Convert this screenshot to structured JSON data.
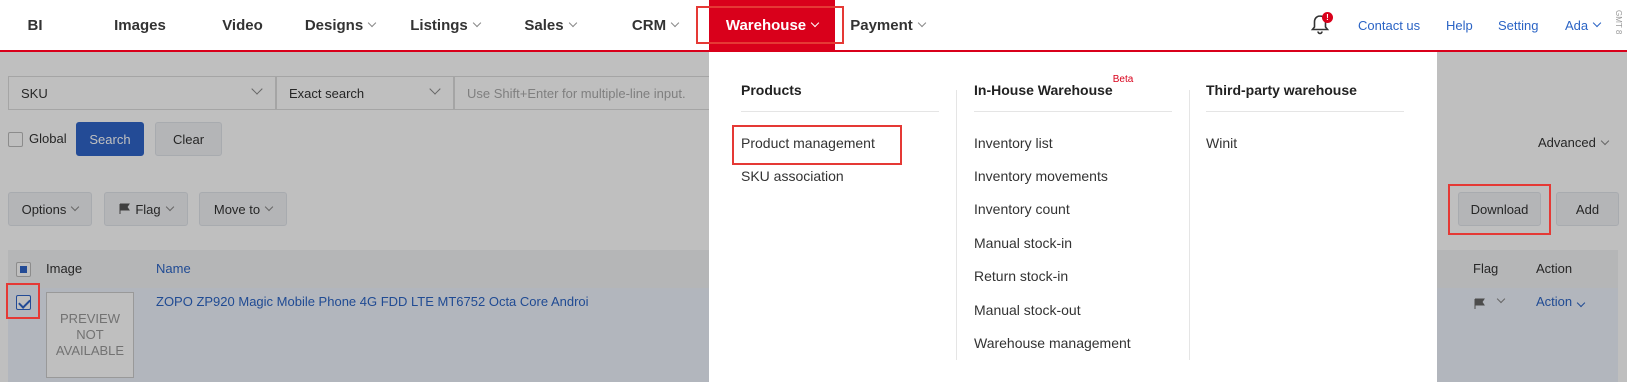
{
  "nav": {
    "items": [
      {
        "label": "BI",
        "has_menu": false
      },
      {
        "label": "Images",
        "has_menu": false
      },
      {
        "label": "Video",
        "has_menu": false
      },
      {
        "label": "Designs",
        "has_menu": true
      },
      {
        "label": "Listings",
        "has_menu": true
      },
      {
        "label": "Sales",
        "has_menu": true
      },
      {
        "label": "CRM",
        "has_menu": true
      },
      {
        "label": "Warehouse",
        "has_menu": true,
        "active": true
      },
      {
        "label": "Payment",
        "has_menu": true
      }
    ],
    "notification_count": "!",
    "contact_label": "Contact us",
    "help_label": "Help",
    "setting_label": "Setting",
    "user_label": "Ada",
    "timezone_label": "GMT 8",
    "accent_color": "#d9001b"
  },
  "search": {
    "field_select": "SKU",
    "mode_select": "Exact search",
    "input_placeholder": "Use Shift+Enter for multiple-line input.",
    "global_label": "Global",
    "search_button": "Search",
    "clear_button": "Clear",
    "advanced_label": "Advanced"
  },
  "toolbar": {
    "options_label": "Options",
    "flag_label": "Flag",
    "move_to_label": "Move to",
    "download_label": "Download",
    "add_label": "Add"
  },
  "table": {
    "headers": {
      "image": "Image",
      "name": "Name",
      "flag": "Flag",
      "action": "Action"
    },
    "rows": [
      {
        "selected": true,
        "image_placeholder": "PREVIEW NOT AVAILABLE",
        "name": "ZOPO ZP920 Magic Mobile Phone 4G FDD LTE MT6752 Octa Core Androi",
        "action": "Action"
      }
    ]
  },
  "warehouse_menu": {
    "columns": [
      {
        "title": "Products",
        "badge": "",
        "items": [
          "Product management",
          "SKU association"
        ]
      },
      {
        "title": "In-House Warehouse",
        "badge": "Beta",
        "items": [
          "Inventory list",
          "Inventory movements",
          "Inventory count",
          "Manual stock-in",
          "Return stock-in",
          "Manual stock-out",
          "Warehouse management"
        ]
      },
      {
        "title": "Third-party warehouse",
        "badge": "",
        "items": [
          "Winit"
        ]
      }
    ]
  }
}
